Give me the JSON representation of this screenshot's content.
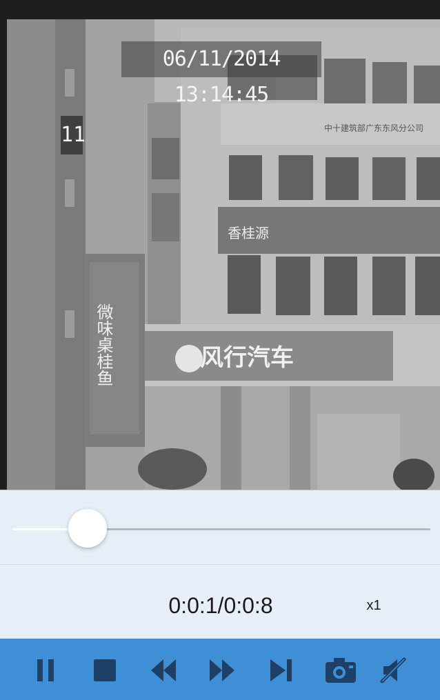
{
  "video": {
    "timestamp": "06/11/2014 13:14:45",
    "channel": "11",
    "signs": {
      "brand": "风行汽车",
      "vertical": "微味桌桂鱼",
      "banner_left": "香桂源",
      "banner_top": "中十建筑部广东东风分公司"
    }
  },
  "playback": {
    "progress": 0.18,
    "time_display": "0:0:1/0:0:8",
    "speed": "x1"
  },
  "colors": {
    "toolbar_bg": "#3f8fd6",
    "toolbar_icon": "#1e3f66",
    "panel_bg": "#e8eef6"
  },
  "toolbar": {
    "buttons": [
      {
        "name": "pause-icon"
      },
      {
        "name": "stop-icon"
      },
      {
        "name": "rewind-icon"
      },
      {
        "name": "fast-forward-icon"
      },
      {
        "name": "step-forward-icon"
      },
      {
        "name": "camera-icon"
      },
      {
        "name": "mute-icon"
      }
    ]
  }
}
